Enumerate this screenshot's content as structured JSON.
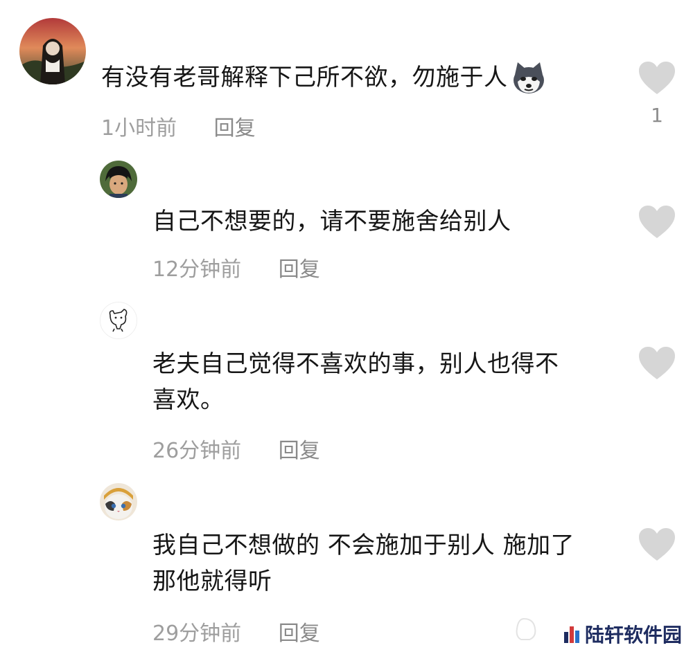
{
  "comments": [
    {
      "text": "有没有老哥解释下己所不欲，勿施于人",
      "emoji": "husky-emoji",
      "time": "1小时前",
      "reply_label": "回复",
      "like_count": "1"
    }
  ],
  "replies": [
    {
      "text": "自己不想要的，请不要施舍给别人",
      "time": "12分钟前",
      "reply_label": "回复"
    },
    {
      "text_lines": [
        "老夫自己觉得不喜欢的事，别人也得不",
        "喜欢。"
      ],
      "time": "26分钟前",
      "reply_label": "回复"
    },
    {
      "text_lines": [
        "我自己不想做的 不会施加于别人 施加了",
        "那他就得听"
      ],
      "time": "29分钟前",
      "reply_label": "回复"
    }
  ],
  "watermark": {
    "text": "陆轩软件园"
  },
  "colors": {
    "heart": "#d6d6d6",
    "meta_text": "#9e9e9e",
    "watermark_text": "#1e2c60"
  }
}
